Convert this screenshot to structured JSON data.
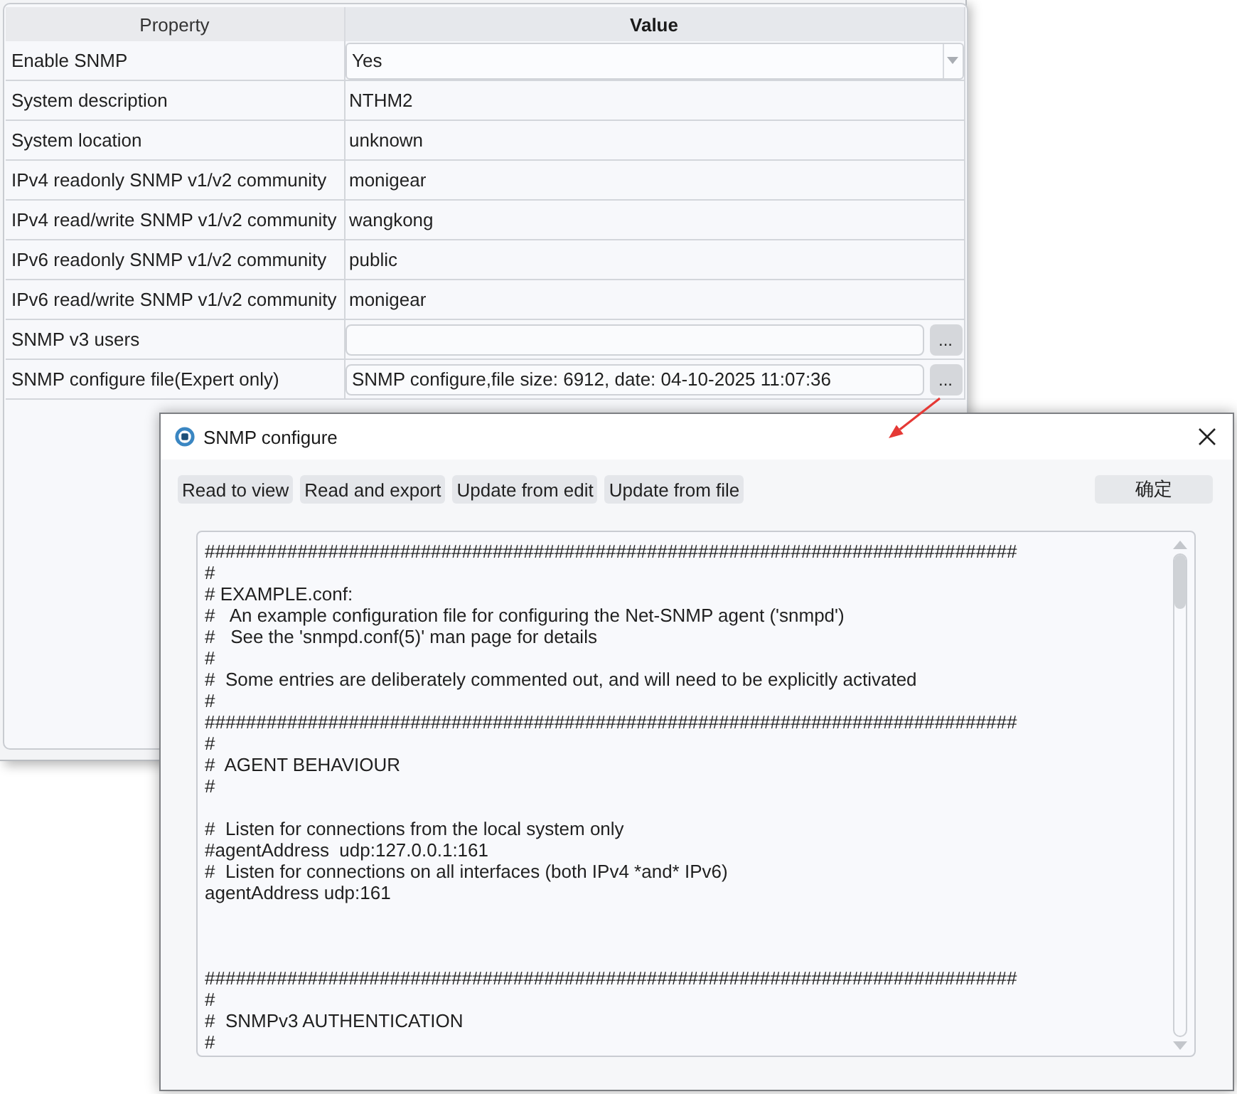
{
  "property_window": {
    "grid": {
      "columns": [
        {
          "label": "Property",
          "selected": false
        },
        {
          "label": "Value",
          "selected": true
        }
      ],
      "rows": [
        {
          "property": "Enable SNMP",
          "kind": "dropdown",
          "value": "Yes"
        },
        {
          "property": "System description",
          "kind": "text",
          "value": "NTHM2"
        },
        {
          "property": "System location",
          "kind": "text",
          "value": "unknown"
        },
        {
          "property": "IPv4 readonly SNMP v1/v2 community",
          "kind": "text",
          "value": "monigear"
        },
        {
          "property": "IPv4 read/write SNMP v1/v2 community",
          "kind": "text",
          "value": "wangkong"
        },
        {
          "property": "IPv6 readonly SNMP v1/v2 community",
          "kind": "text",
          "value": "public"
        },
        {
          "property": "IPv6 read/write SNMP v1/v2 community",
          "kind": "text",
          "value": "monigear"
        },
        {
          "property": "SNMP v3 users",
          "kind": "browse",
          "button": "..."
        },
        {
          "property": "SNMP configure file(Expert only)",
          "kind": "browse",
          "value": "SNMP configure,file size: 6912, date: 04-10-2025 11:07:36",
          "button": "..."
        }
      ]
    }
  },
  "dialog": {
    "title": "SNMP configure",
    "toolbar": [
      "Read to view",
      "Read and export",
      "Update from edit",
      "Update from file"
    ],
    "confirm_button": "确定",
    "config_text": "###############################################################################\n#\n# EXAMPLE.conf:\n#   An example configuration file for configuring the Net-SNMP agent ('snmpd')\n#   See the 'snmpd.conf(5)' man page for details\n#\n#  Some entries are deliberately commented out, and will need to be explicitly activated\n#\n###############################################################################\n#\n#  AGENT BEHAVIOUR\n#\n\n#  Listen for connections from the local system only\n#agentAddress  udp:127.0.0.1:161\n#  Listen for connections on all interfaces (both IPv4 *and* IPv6)\nagentAddress udp:161\n\n\n\n###############################################################################\n#\n#  SNMPv3 AUTHENTICATION\n#"
  }
}
